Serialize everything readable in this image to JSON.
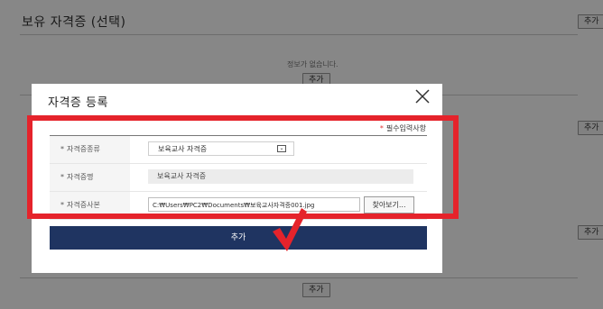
{
  "background": {
    "section_title": "보유 자격증 (선택)",
    "empty_message": "정보가 없습니다.",
    "add_label": "추가"
  },
  "modal": {
    "title": "자격증 등록",
    "required_note": "필수입력사항",
    "required_mark": "*",
    "fields": {
      "type_label": "자격증종류",
      "type_value": "보육교사 자격증",
      "name_label": "자격증명",
      "name_value": "보육교사 자격증",
      "copy_label": "자격증사본",
      "file_path": "C:₩Users₩PC2₩Documents₩보육교사자격증001.jpg",
      "browse_label": "찾아보기..."
    },
    "submit_label": "추가"
  },
  "colors": {
    "accent_navy": "#1f3461",
    "highlight_red": "#e5232b",
    "overlay": "rgba(0,0,0,0.47)"
  },
  "icons": {
    "close": "close-icon",
    "dropdown": "chevron-down-icon",
    "annotation": "checkmark-icon"
  }
}
